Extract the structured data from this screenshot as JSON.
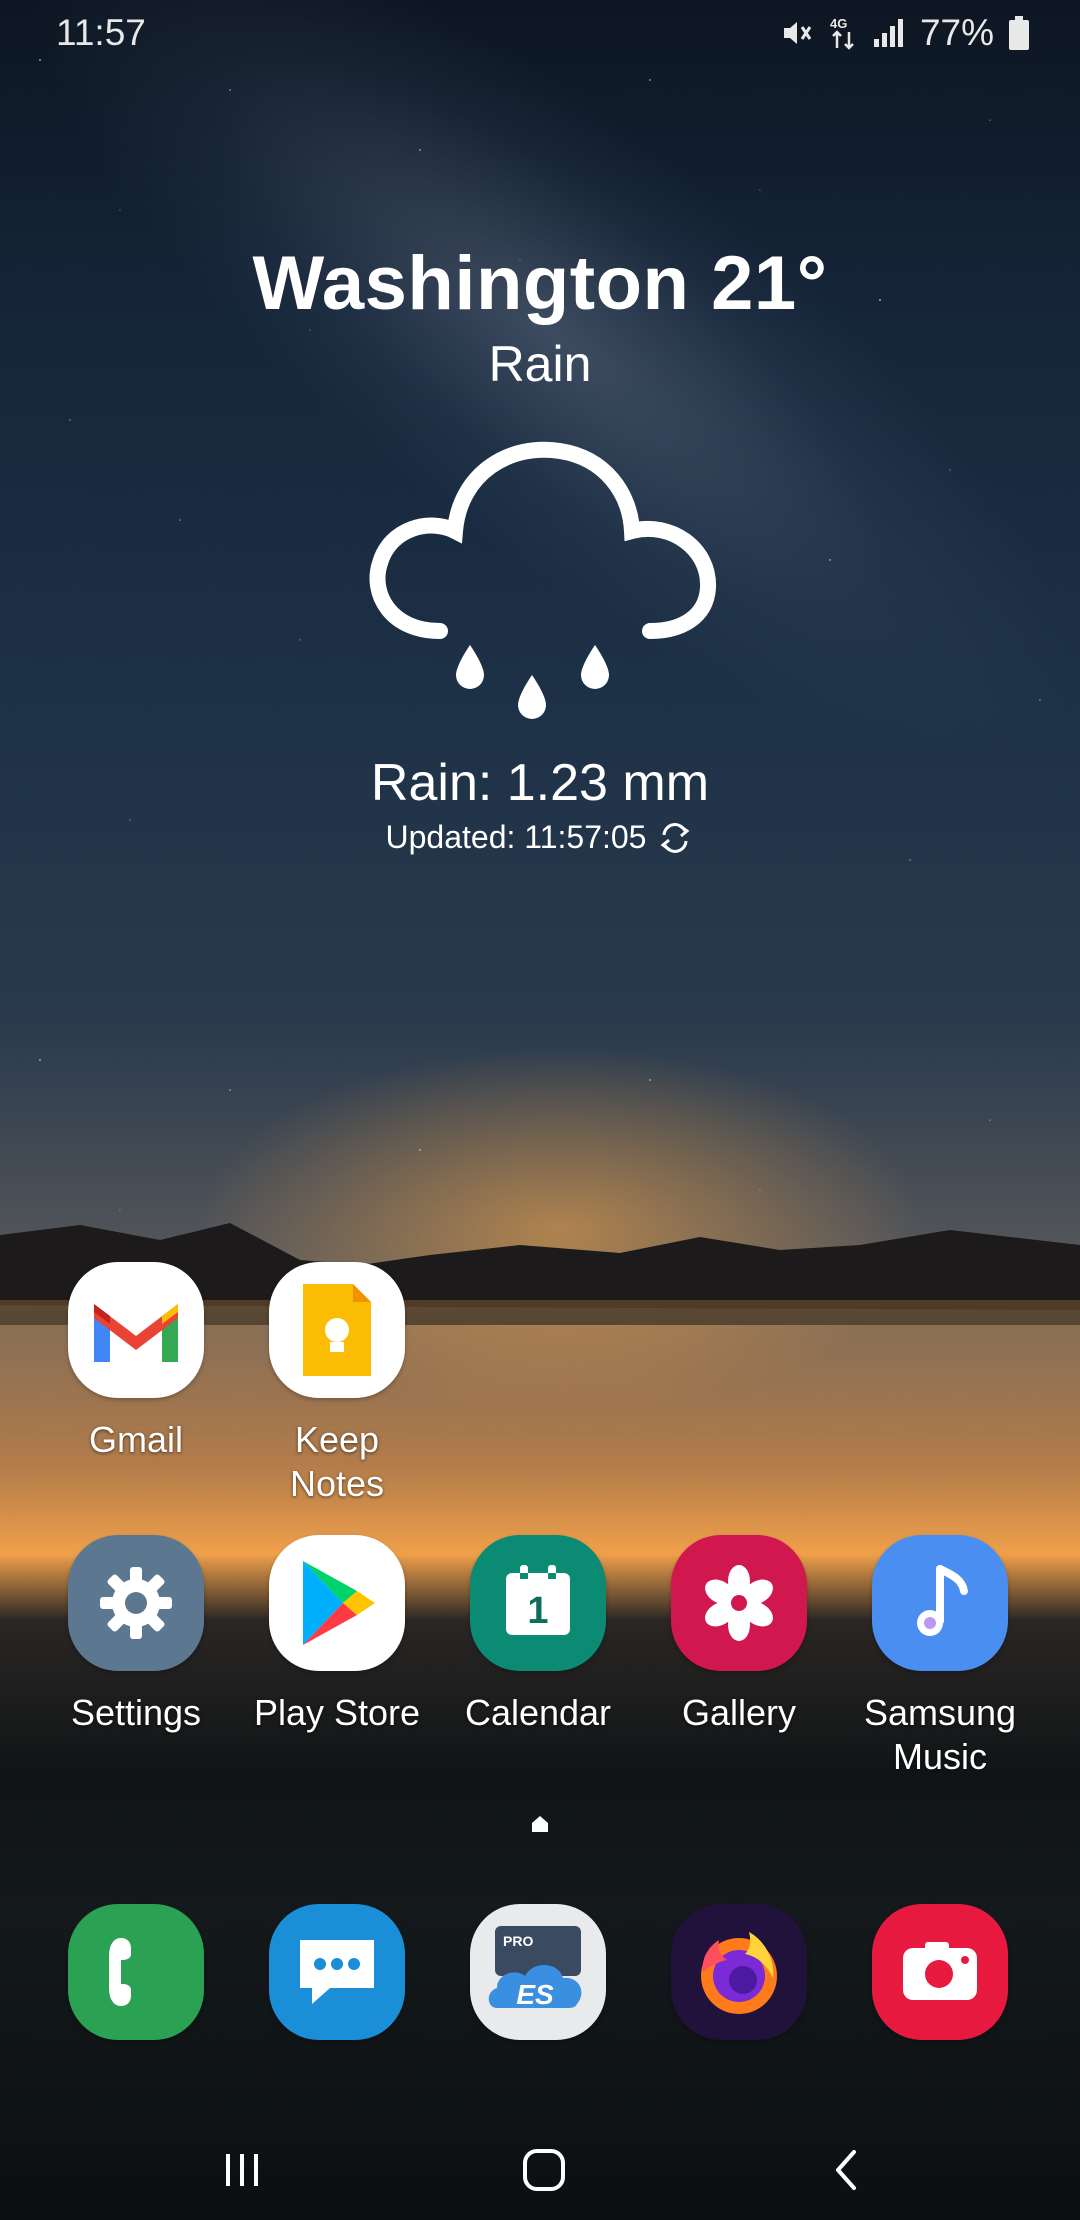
{
  "status_bar": {
    "time": "11:57",
    "battery": "77%",
    "network": "4G",
    "icons": [
      "mute-vibrate-icon",
      "network-4g-icon",
      "signal-icon",
      "battery-icon"
    ]
  },
  "weather": {
    "title": "Washington 21°",
    "condition": "Rain",
    "icon": "rain-cloud-icon",
    "precip": "Rain: 1.23 mm",
    "updated": "Updated: 11:57:05"
  },
  "home_apps": [
    {
      "label": "Gmail",
      "icon": "gmail-icon"
    },
    {
      "label": "Keep\nNotes",
      "icon": "keep-notes-icon"
    },
    {
      "label": "Settings",
      "icon": "settings-icon"
    },
    {
      "label": "Play Store",
      "icon": "play-store-icon"
    },
    {
      "label": "Calendar",
      "icon": "calendar-icon",
      "day": "1"
    },
    {
      "label": "Gallery",
      "icon": "gallery-icon"
    },
    {
      "label": "Samsung\nMusic",
      "icon": "samsung-music-icon"
    }
  ],
  "dock": {
    "apps": [
      {
        "icon": "phone-icon"
      },
      {
        "icon": "messages-icon"
      },
      {
        "icon": "es-file-explorer-pro-icon",
        "badge": "PRO"
      },
      {
        "icon": "firefox-icon"
      },
      {
        "icon": "screen-recorder-icon"
      }
    ]
  },
  "colors": {
    "gmail_bg": "#ffffff",
    "keep_bg": "#ffffff",
    "settings_bg": "#5c7891",
    "play_bg": "#ffffff",
    "calendar_bg": "#0b8a74",
    "gallery_bg": "#d0184f",
    "music_bg": "#4a8ef1",
    "phone_bg": "#2ba154",
    "messages_bg": "#1a8fd8",
    "es_bg": "#e8eaec",
    "firefox_bg": "#20123a",
    "recorder_bg": "#e8193f"
  },
  "navigation": {
    "buttons": [
      "recents-button",
      "home-button",
      "back-button"
    ]
  }
}
